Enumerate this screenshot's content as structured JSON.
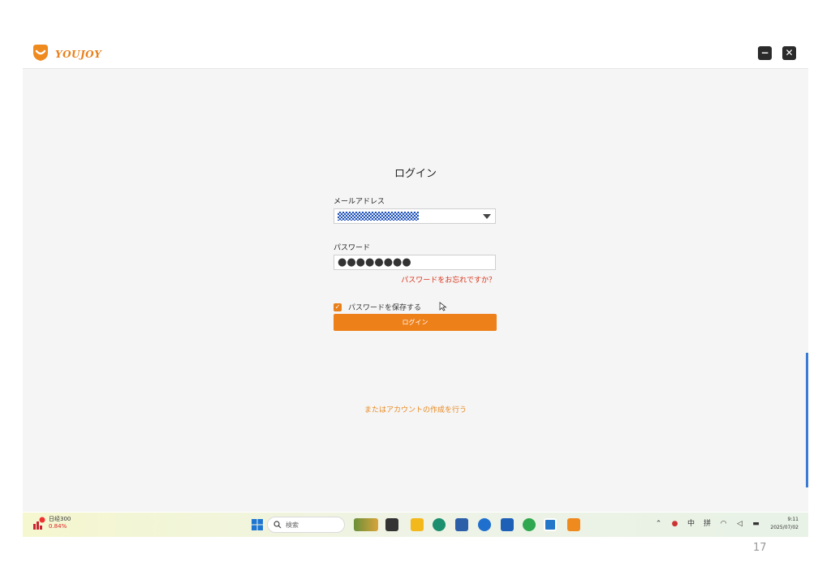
{
  "app": {
    "logo_text": "YOUJOY",
    "colors": {
      "accent": "#ee8019",
      "link_red": "#d9331a",
      "background": "#f5f5f5"
    }
  },
  "window_controls": {
    "minimize_icon": "minimize-icon",
    "close_icon": "close-icon",
    "minimize_glyph": "−",
    "close_glyph": "✕"
  },
  "login": {
    "title": "ログイン",
    "email_label": "メールアドレス",
    "password_label": "パスワード",
    "password_value": "●●●●●●●●",
    "forgot_link": "パスワードをお忘れですか？",
    "remember_label": "パスワードを保存する",
    "remember_checked": "✓",
    "submit_label": "ログイン",
    "signup_link": "またはアカウントの作成を行う"
  },
  "taskbar": {
    "stock_name": "日经300",
    "stock_change": "0.84%",
    "search_placeholder": "検索",
    "tray_ime": "中",
    "tray_input": "拼",
    "clock_time": "9:11",
    "clock_date": "2025/07/02"
  },
  "slide": {
    "page_number": "17"
  }
}
